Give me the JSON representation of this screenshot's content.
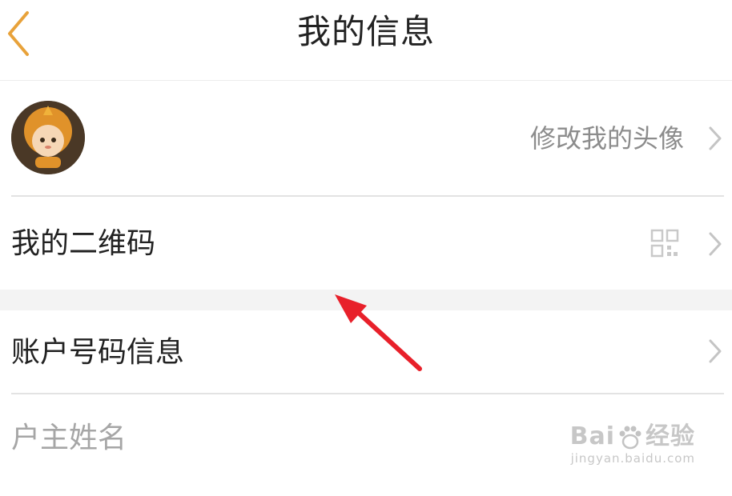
{
  "header": {
    "title": "我的信息"
  },
  "rows": {
    "avatar": {
      "action_label": "修改我的头像"
    },
    "qrcode": {
      "label": "我的二维码"
    },
    "account": {
      "label": "账户号码信息"
    },
    "owner_name": {
      "label": "户主姓名"
    }
  },
  "watermark": {
    "main_left": "Bai",
    "main_right": "经验",
    "sub": "jingyan.baidu.com"
  },
  "colors": {
    "back_arrow": "#e8a23a",
    "annotation_arrow": "#e8202a",
    "chevron": "#c4c4c4"
  }
}
